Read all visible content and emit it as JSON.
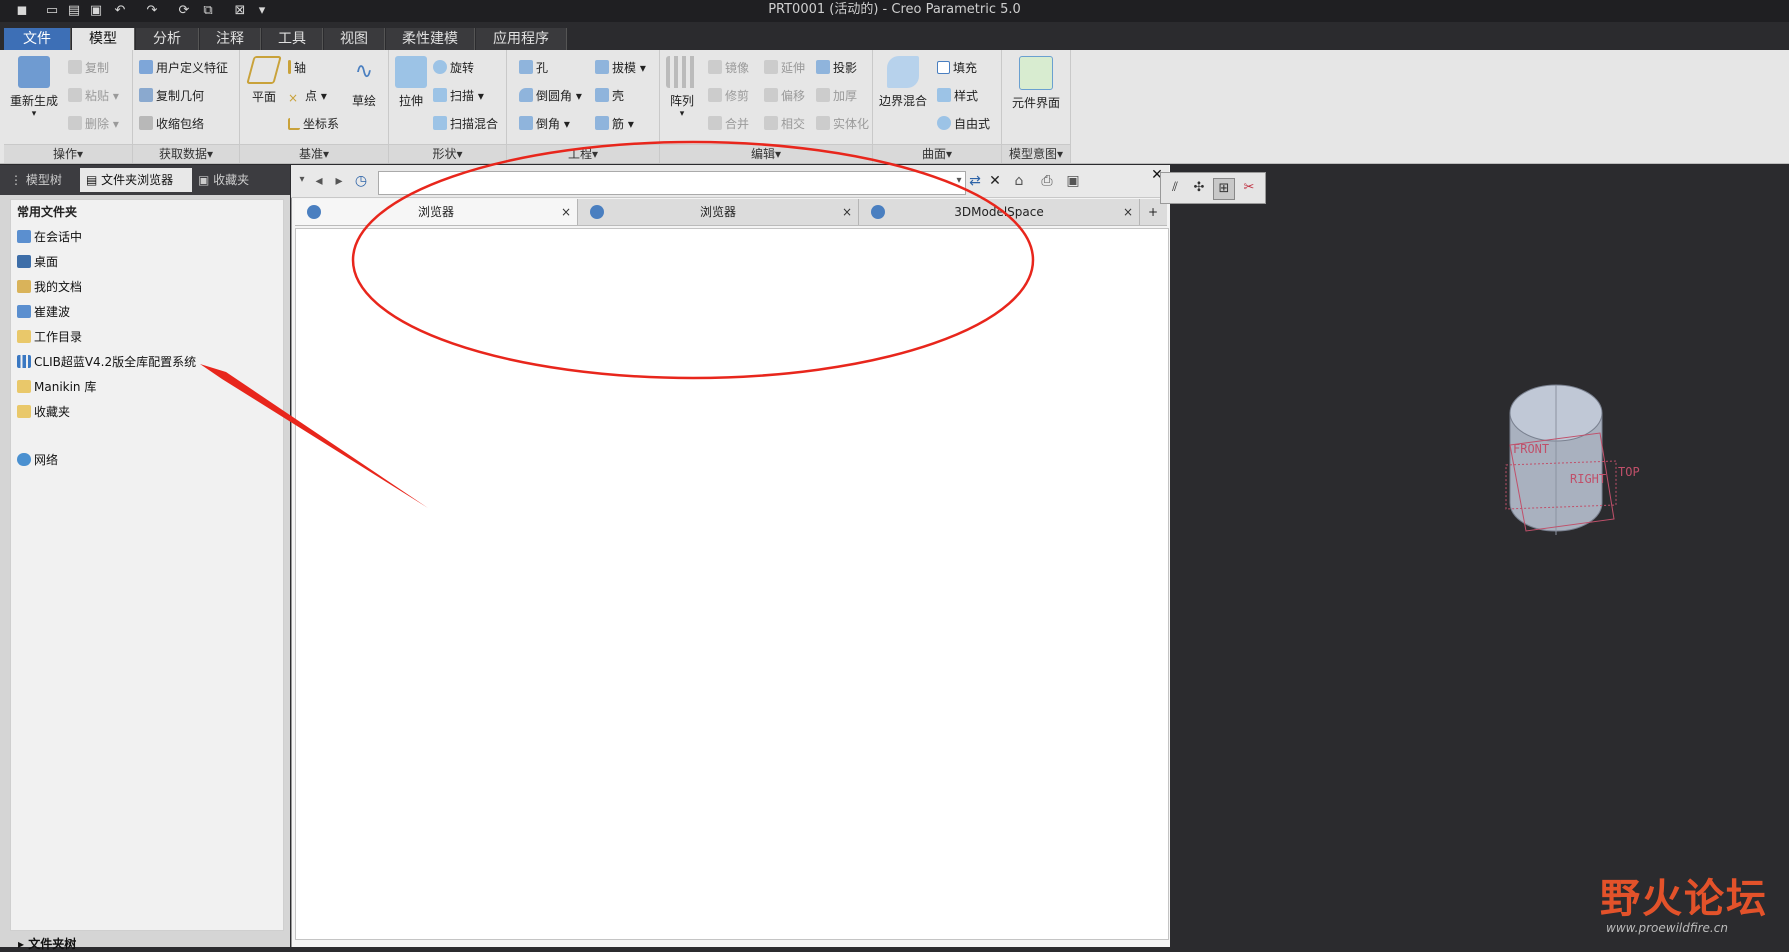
{
  "window": {
    "title": "PRT0001 (活动的) - Creo Parametric 5.0"
  },
  "ribbon_tabs": [
    {
      "label": "文件"
    },
    {
      "label": "模型",
      "active": true
    },
    {
      "label": "分析"
    },
    {
      "label": "注释"
    },
    {
      "label": "工具"
    },
    {
      "label": "视图"
    },
    {
      "label": "柔性建模"
    },
    {
      "label": "应用程序"
    }
  ],
  "ribbon": {
    "operations": {
      "group_label": "操作▾",
      "regen": "重新生成",
      "copy": "复制",
      "paste": "粘贴",
      "delete": "删除"
    },
    "get_data": {
      "group_label": "获取数据▾",
      "udf": "用户定义特征",
      "copy_geom": "复制几何",
      "shrinkwrap": "收缩包络"
    },
    "datum": {
      "group_label": "基准▾",
      "plane": "平面",
      "axis": "轴",
      "point": "点",
      "csys": "坐标系",
      "sketch": "草绘"
    },
    "shapes": {
      "group_label": "形状▾",
      "extrude": "拉伸",
      "revolve": "旋转",
      "sweep": "扫描",
      "swept_blend": "扫描混合"
    },
    "engineering": {
      "group_label": "工程▾",
      "hole": "孔",
      "round": "倒圆角",
      "chamfer": "倒角",
      "draft": "拔模",
      "shell": "壳",
      "rib": "筋"
    },
    "editing": {
      "group_label": "编辑▾",
      "pattern": "阵列",
      "mirror": "镜像",
      "trim": "修剪",
      "merge": "合并",
      "extend": "延伸",
      "offset": "偏移",
      "intersect": "相交",
      "project": "投影",
      "thicken": "加厚",
      "solidify": "实体化"
    },
    "surfaces": {
      "group_label": "曲面▾",
      "boundary_blend": "边界混合",
      "fill": "填充",
      "style": "样式",
      "freestyle": "自由式"
    },
    "model_intent": {
      "group_label": "模型意图▾",
      "component_interface": "元件界面"
    }
  },
  "left_panel": {
    "tabs": [
      "模型树",
      "文件夹浏览器",
      "收藏夹"
    ],
    "common_folders_header": "常用文件夹",
    "folders": [
      "在会话中",
      "桌面",
      "我的文档",
      "崔建波",
      "工作目录",
      "CLIB超蓝V4.2版全库配置系统",
      "Manikin 库",
      "收藏夹"
    ],
    "network": "网络",
    "tree_header": "文件夹树"
  },
  "browser": {
    "address_value": "",
    "tabs": [
      {
        "label": "浏览器",
        "active": true
      },
      {
        "label": "浏览器"
      },
      {
        "label": "3DModelSpace"
      }
    ],
    "close_glyph": "×",
    "add_glyph": "+"
  },
  "graphics": {
    "datum_labels": [
      "FRONT",
      "RIGHT",
      "TOP"
    ],
    "cylinder_color": "#a9b1bf",
    "datum_color": "#c0506a"
  },
  "watermark": {
    "text": "野火论坛",
    "url": "www.proewildfire.cn"
  },
  "annotations": {
    "circle_color": "#e8261c",
    "arrow_color": "#e8261c"
  }
}
